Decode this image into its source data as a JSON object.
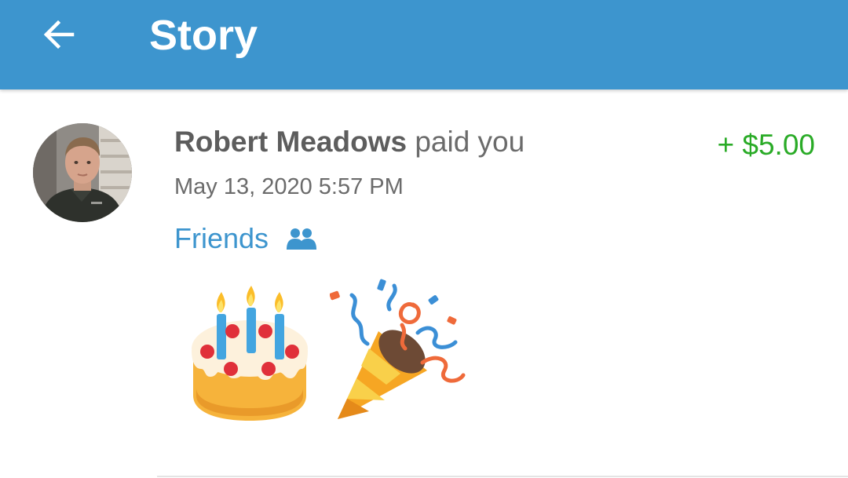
{
  "app_bar": {
    "title": "Story",
    "back_icon": "arrow-left-icon",
    "background_color": "#3d95ce"
  },
  "story": {
    "actor_name": "Robert Meadows",
    "action_text": " paid you",
    "amount": "+ $5.00",
    "amount_color": "#2aab27",
    "date": "May 13, 2020 5:57 PM",
    "audience": "Friends",
    "audience_icon": "friends-icon",
    "note_emojis": [
      "birthday-cake-icon",
      "party-popper-icon"
    ]
  }
}
